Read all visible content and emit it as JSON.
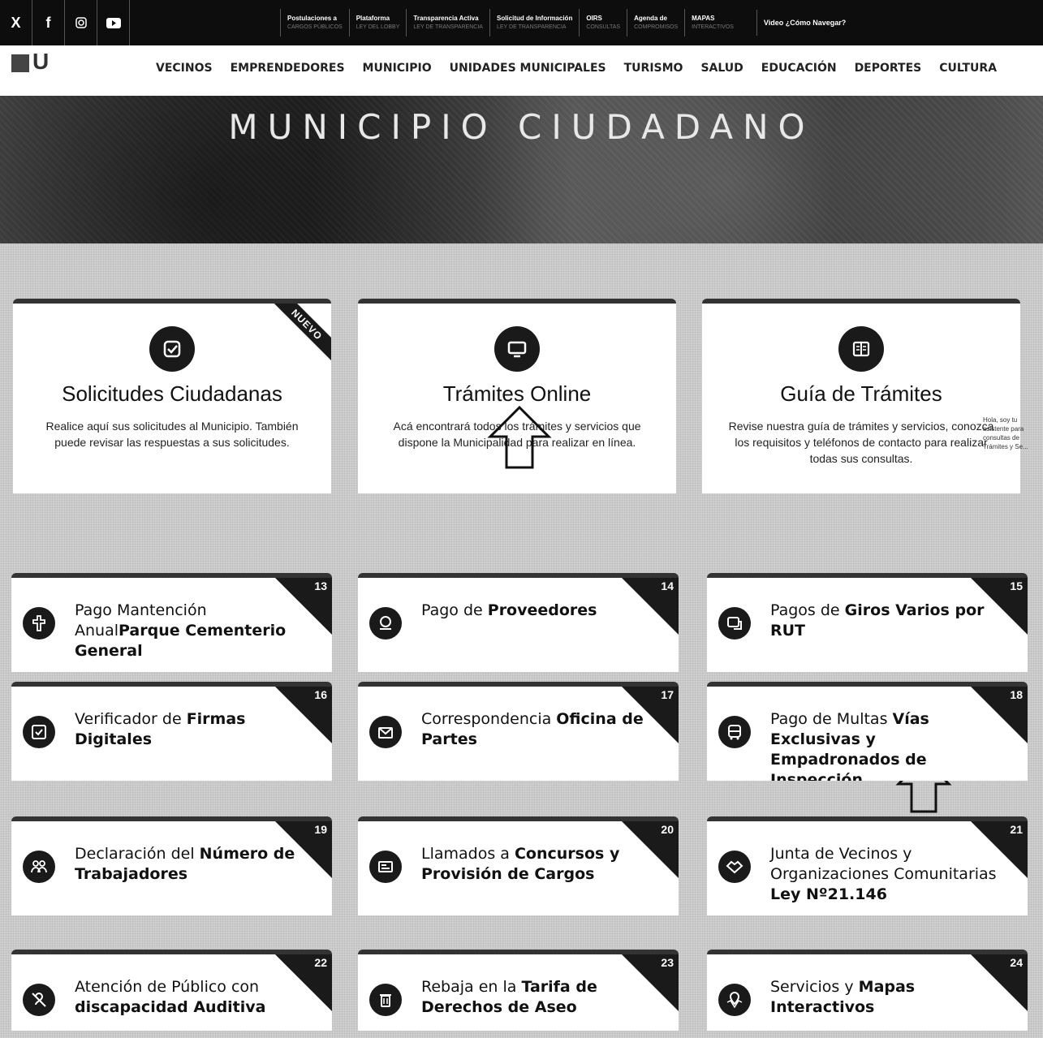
{
  "topbar": {
    "social": [
      "X",
      "f",
      "instagram",
      "youtube"
    ],
    "links": [
      {
        "t1": "Postulaciones a",
        "t2": "CARGOS PÚBLICOS"
      },
      {
        "t1": "Plataforma",
        "t2": "LEY DEL LOBBY"
      },
      {
        "t1": "Transparencia Activa",
        "t2": "LEY DE TRANSPARENCIA"
      },
      {
        "t1": "Solicitud de Información",
        "t2": "LEY DE TRANSPARENCIA"
      },
      {
        "t1": "OIRS",
        "t2": "CONSULTAS"
      },
      {
        "t1": "Agenda de",
        "t2": "COMPROMISOS"
      },
      {
        "t1": "MAPAS",
        "t2": "INTERACTIVOS"
      }
    ],
    "video": "Video ¿Cómo Navegar?"
  },
  "logo": "U",
  "menu": [
    "VECINOS",
    "EMPRENDEDORES",
    "MUNICIPIO",
    "UNIDADES MUNICIPALES",
    "TURISMO",
    "SALUD",
    "EDUCACIÓN",
    "DEPORTES",
    "CULTURA"
  ],
  "hero": {
    "title": "MUNICIPIO CIUDADANO"
  },
  "features": [
    {
      "title": "Solicitudes Ciudadanas",
      "text": "Realice aquí sus solicitudes al Municipio. También puede revisar las respuestas a sus solicitudes.",
      "ribbon": "NUEVO",
      "icon": "edit-check-icon"
    },
    {
      "title": "Trámites Online",
      "text": "Acá encontrará todos los trámites y servicios que dispone la Municipalidad para realizar en línea.",
      "icon": "monitor-icon"
    },
    {
      "title": "Guía de Trámites",
      "text": "Revise nuestra guía de trámites y servicios, conozca los requisitos y teléfonos de contacto para realizar todas sus consultas.",
      "icon": "book-icon"
    }
  ],
  "chat_hint": "Hola, soy tu asistente para consultas de Trámites y Se...",
  "tiles": [
    {
      "num": "13",
      "plain": "Pago Mantención Anual",
      "bold": "Parque Cementerio General",
      "icon": "cross-icon"
    },
    {
      "num": "14",
      "plain": "Pago de ",
      "bold": "Proveedores",
      "icon": "payment-icon"
    },
    {
      "num": "15",
      "plain": "Pagos de ",
      "bold": "Giros Varios por RUT",
      "icon": "id-card-icon"
    },
    {
      "num": "16",
      "plain": "Verificador de ",
      "bold": "Firmas Digitales",
      "icon": "signature-check-icon"
    },
    {
      "num": "17",
      "plain": "Correspondencia ",
      "bold": "Oficina de Partes",
      "icon": "mail-icon"
    },
    {
      "num": "18",
      "plain": "Pago de Multas ",
      "bold": "Vías Exclusivas y Empadronados de Inspección",
      "icon": "bus-icon"
    },
    {
      "num": "19",
      "plain": "Declaración del ",
      "bold": "Número de Trabajadores",
      "icon": "workers-icon"
    },
    {
      "num": "20",
      "plain": "Llamados a ",
      "bold": "Concursos y Provisión de Cargos",
      "icon": "board-icon"
    },
    {
      "num": "21",
      "plain": "Junta de Vecinos y Organizaciones Comunitarias ",
      "bold": "Ley Nº21.146",
      "icon": "handshake-icon"
    },
    {
      "num": "22",
      "plain": "Atención de Público con ",
      "bold": "discapacidad Auditiva",
      "icon": "ear-off-icon"
    },
    {
      "num": "23",
      "plain": "Rebaja en la ",
      "bold": "Tarifa de Derechos de Aseo",
      "icon": "trash-icon"
    },
    {
      "num": "24",
      "plain": "Servicios y ",
      "bold": "Mapas Interactivos",
      "icon": "map-pin-icon"
    }
  ]
}
